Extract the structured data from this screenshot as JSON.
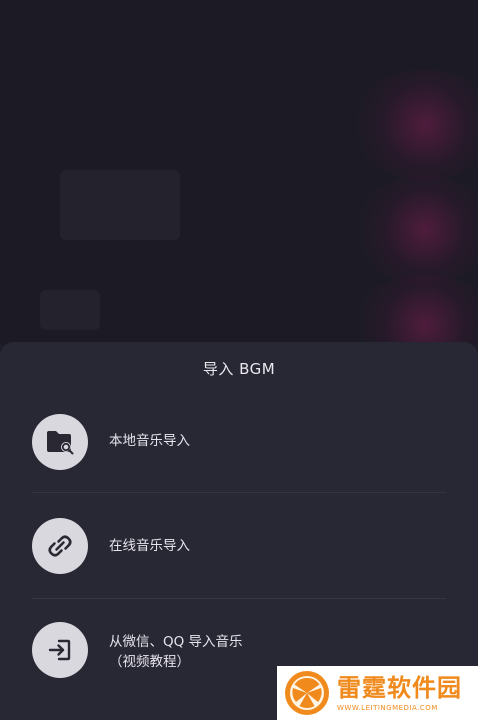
{
  "sheet": {
    "title": "导入 BGM",
    "options": [
      {
        "label": "本地音乐导入",
        "icon": "folder-search-icon"
      },
      {
        "label": "在线音乐导入",
        "icon": "link-icon"
      },
      {
        "label_line1": "从微信、QQ 导入音乐",
        "label_line2": "（视频教程）",
        "icon": "import-icon"
      }
    ]
  },
  "watermark": {
    "title": "雷霆软件园",
    "url": "WWW.LEITINGMEDIA.COM",
    "accent": "#f08a1c"
  },
  "colors": {
    "sheet_bg": "#282734",
    "icon_circle": "#d9d8df",
    "icon_glyph": "#2a2933",
    "text": "#e6e5ec"
  }
}
